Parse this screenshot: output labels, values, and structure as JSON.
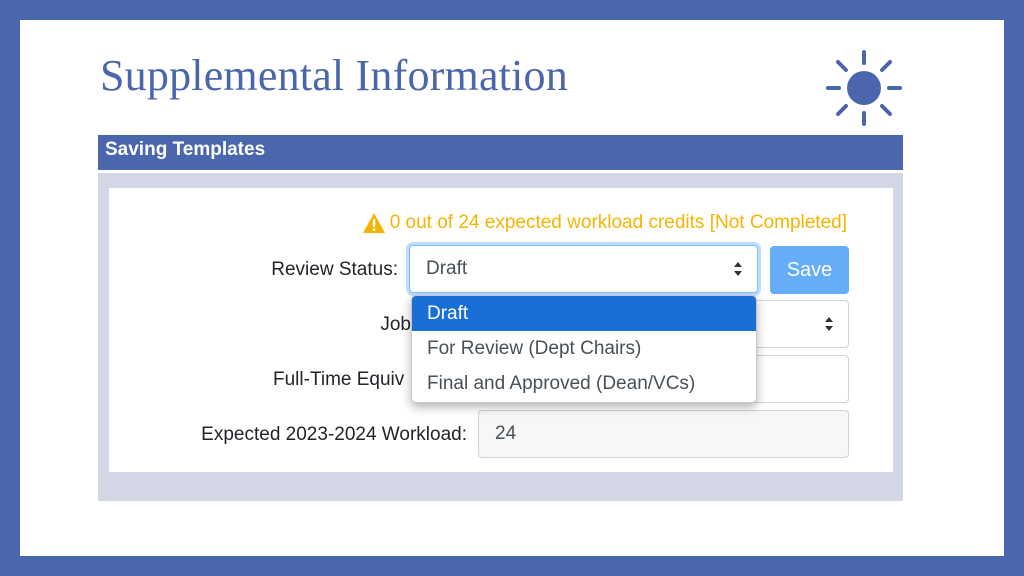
{
  "slide": {
    "title": "Supplemental Information",
    "sun_icon": "sun-icon"
  },
  "colors": {
    "frame": "#4a66ad",
    "title": "#4a66ad",
    "warning": "#f5b400",
    "save_button": "#66adf8",
    "selected_option": "#1a6fd6"
  },
  "panel": {
    "header": "Saving Templates"
  },
  "form": {
    "warning_icon": "warning-triangle-icon",
    "warning_text": "0 out of 24 expected workload credits [Not Completed]",
    "review_status_label": "Review Status:",
    "review_status_value": "Draft",
    "save_label": "Save",
    "job_label": "Job",
    "fte_label": "Full-Time Equiv",
    "expected_workload_label": "Expected 2023-2024 Workload:",
    "expected_workload_value": "24"
  },
  "dropdown": {
    "options": [
      {
        "label": "Draft",
        "selected": true
      },
      {
        "label": "For Review (Dept Chairs)",
        "selected": false
      },
      {
        "label": "Final and Approved (Dean/VCs)",
        "selected": false
      }
    ]
  }
}
